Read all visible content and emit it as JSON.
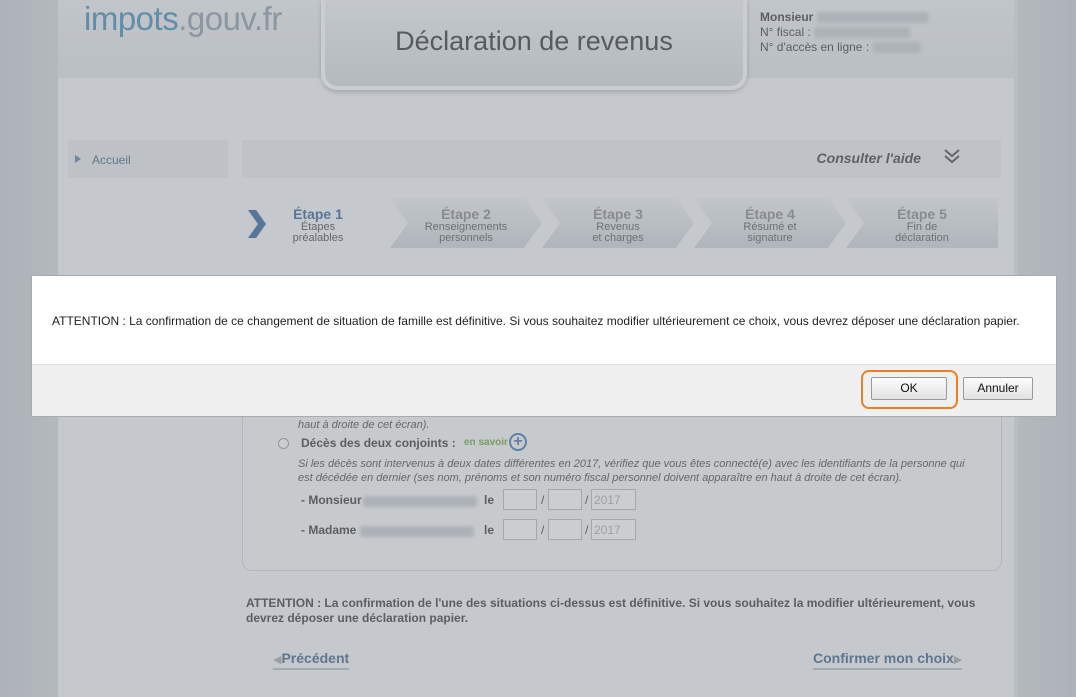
{
  "header": {
    "logo_part1": "impots",
    "logo_part2": ".gouv.fr",
    "page_title": "Déclaration de revenus",
    "user_title": "Monsieur",
    "fiscal_label": "N° fiscal :",
    "access_label": "N° d'accès en ligne :"
  },
  "nav": {
    "accueil": "Accueil"
  },
  "help": {
    "label": "Consulter l'aide",
    "chevron_icon": "double-chevron-down-icon"
  },
  "steps": [
    {
      "title": "Étape 1",
      "sub1": "Étapes",
      "sub2": "préalables"
    },
    {
      "title": "Étape 2",
      "sub1": "Renseignements",
      "sub2": "personnels"
    },
    {
      "title": "Étape 3",
      "sub1": "Revenus",
      "sub2": "et charges"
    },
    {
      "title": "Étape 4",
      "sub1": "Résumé et",
      "sub2": "signature"
    },
    {
      "title": "Étape 5",
      "sub1": "Fin de",
      "sub2": "déclaration"
    }
  ],
  "form": {
    "partial_text": "haut à droite de cet écran).",
    "deces_label": "Décès des deux conjoints :",
    "en_savoir": "en savoir",
    "deces_help_1": "Si les décès sont intervenus à deux dates différentes en 2017, vérifiez que vous êtes connecté(e) avec les identifiants de la personne qui",
    "deces_help_2": "est décédée en dernier (ses nom, prénoms et son numéro fiscal personnel doivent apparaître en haut à droite de cet écran).",
    "monsieur_label": "- Monsieur",
    "madame_label": "- Madame",
    "le": "le",
    "year_placeholder": "2017"
  },
  "warning": "ATTENTION : La confirmation de l'une des situations ci-dessus est définitive. Si vous souhaitez la modifier ultérieurement, vous devrez déposer une déclaration papier.",
  "footer_nav": {
    "prev": "Précédent",
    "next": "Confirmer mon choix"
  },
  "dialog": {
    "message": "ATTENTION : La confirmation de ce changement de situation de famille est définitive. Si vous souhaitez modifier ultérieurement ce choix, vous devrez déposer une déclaration papier.",
    "ok": "OK",
    "cancel": "Annuler"
  },
  "colors": {
    "accent": "#2c5f9a",
    "highlight": "#ef7f23"
  }
}
